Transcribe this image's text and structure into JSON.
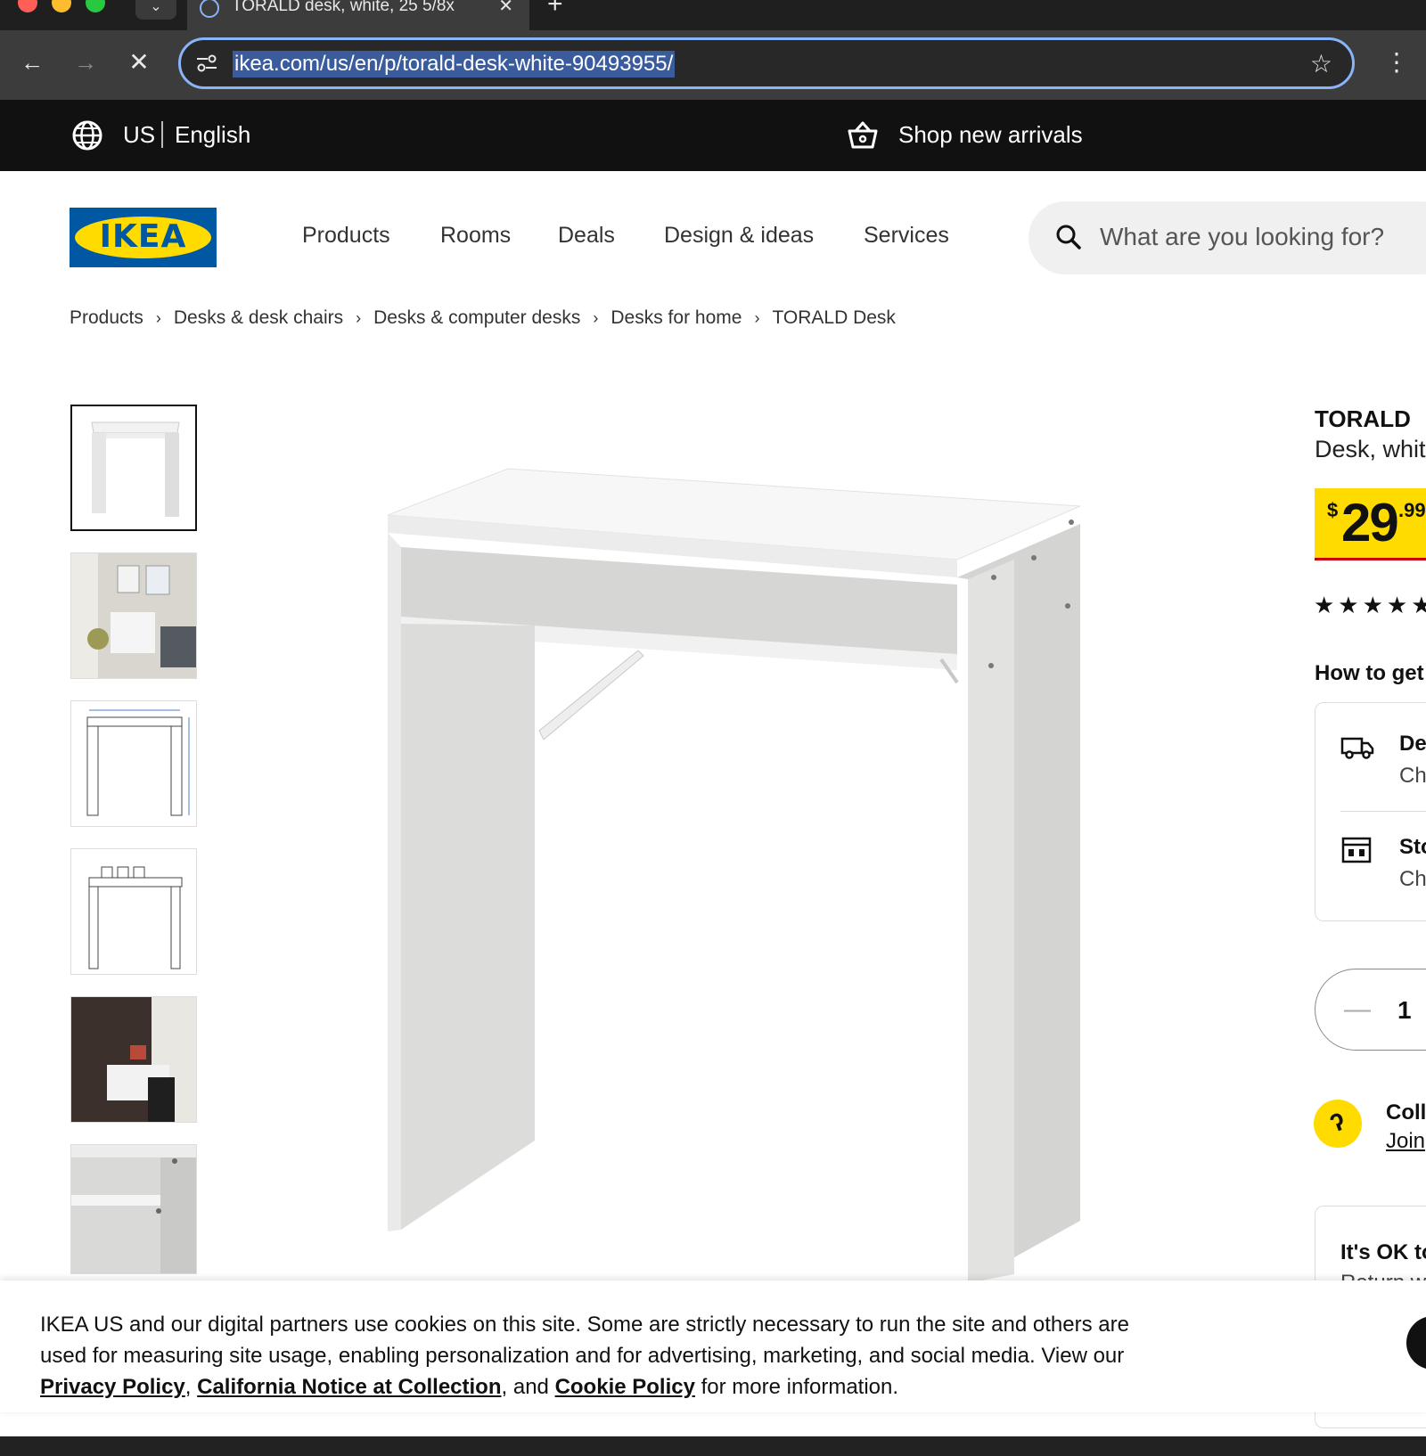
{
  "browser": {
    "tab_title": "TORALD desk, white, 25 5/8x",
    "url": "ikea.com/us/en/p/torald-desk-white-90493955/"
  },
  "topbar": {
    "country": "US",
    "language": "English",
    "promo": "Shop new arrivals"
  },
  "header": {
    "logo_text": "IKEA",
    "nav": [
      "Products",
      "Rooms",
      "Deals",
      "Design & ideas",
      "Services"
    ],
    "search_placeholder": "What are you looking for?"
  },
  "breadcrumb": [
    "Products",
    "Desks & desk chairs",
    "Desks & computer desks",
    "Desks for home",
    "TORALD Desk"
  ],
  "product": {
    "name": "TORALD",
    "description": "Desk, whit",
    "price_currency": "$",
    "price_integer": "29",
    "price_decimal": ".99",
    "stars": "★★★★★",
    "how_to_get": "How to get",
    "delivery_title": "De",
    "delivery_sub": "Ch",
    "store_title": "Sto",
    "store_sub": "Ch",
    "quantity": "1",
    "rewards_title": "Coll",
    "rewards_link": "Join",
    "ok_title": "It's OK to",
    "ok_sub": "Return w"
  },
  "cookie_banner": {
    "text_1": "IKEA US and our digital partners use cookies on this site. Some are strictly necessary to run the site and others are used for measuring site usage, enabling personalization and for advertising, marketing, and social media. View our ",
    "link_privacy": "Privacy Policy",
    "sep_1": ", ",
    "link_california": "California Notice at Collection",
    "sep_2": ", and ",
    "link_cookie": "Cookie Policy",
    "text_2": " for more information."
  },
  "colors": {
    "ikea_blue": "#0058a3",
    "ikea_yellow": "#ffdb00",
    "price_red": "#cc0008",
    "topbar": "#111111"
  },
  "icons": [
    "globe-icon",
    "basket-icon",
    "search-icon",
    "truck-icon",
    "store-icon",
    "star-icon",
    "rewards-icon"
  ]
}
